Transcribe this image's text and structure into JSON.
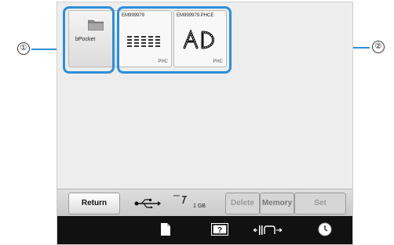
{
  "callouts": {
    "first": "①",
    "second": "②"
  },
  "slots": {
    "folder": {
      "label": "bPocket"
    },
    "file1": {
      "name": "EM999979",
      "format": "PHC"
    },
    "file2": {
      "name": "EM999979.PHCE",
      "format": "PHC"
    }
  },
  "toolbar": {
    "return_label": "Return",
    "capacity": "1 GB",
    "delete_label": "Delete",
    "memory_label": "Memory",
    "set_label": "Set"
  },
  "colors": {
    "highlight": "#2f8fd8",
    "statusbar": "#111111"
  },
  "icons": [
    "folder-icon",
    "usb-icon",
    "card-icon",
    "document-icon",
    "help-icon",
    "width-icon",
    "clock-icon"
  ]
}
